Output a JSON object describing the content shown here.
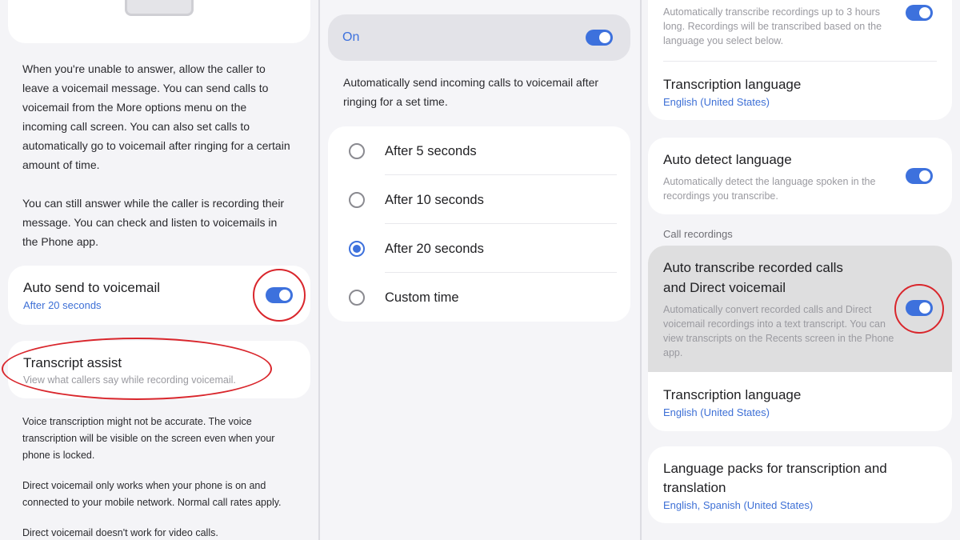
{
  "left_panel": {
    "description_paragraph_1": "When you're unable to answer, allow the caller to leave a voicemail message. You can send calls to voicemail from the More options menu on the incoming call screen. You can also set calls to automatically go to voicemail after ringing for a certain amount of time.",
    "description_paragraph_2": "You can still answer while the caller is recording their message. You can check and listen to voicemails in the Phone app.",
    "auto_send": {
      "title": "Auto send to voicemail",
      "subtitle": "After 20 seconds"
    },
    "transcript_assist": {
      "title": "Transcript assist",
      "subtitle": "View what callers say while recording voicemail."
    },
    "note_1": "Voice transcription might not be accurate. The voice transcription will be visible on the screen even when your phone is locked.",
    "note_2": "Direct voicemail only works when your phone is on and connected to your mobile network. Normal call rates apply.",
    "note_3": "Direct voicemail doesn't work for video calls."
  },
  "middle_panel": {
    "master_switch_label": "On",
    "description": "Automatically send incoming calls to voicemail after ringing for a set time.",
    "options": [
      {
        "label": "After 5 seconds",
        "selected": false
      },
      {
        "label": "After 10 seconds",
        "selected": false
      },
      {
        "label": "After 20 seconds",
        "selected": true
      },
      {
        "label": "Custom time",
        "selected": false
      }
    ]
  },
  "right_panel": {
    "top_card_description": "Automatically transcribe recordings up to 3 hours long. Recordings will be transcribed based on the language you select below.",
    "transcription_language_1": {
      "title": "Transcription language",
      "value": "English (United States)"
    },
    "auto_detect": {
      "title": "Auto detect language",
      "description": "Automatically detect the language spoken in the recordings you transcribe."
    },
    "section_header": "Call recordings",
    "auto_transcribe": {
      "title_line_1": "Auto transcribe recorded calls",
      "title_line_2": "and Direct voicemail",
      "description": "Automatically convert recorded calls and Direct voicemail recordings into a text transcript. You can view transcripts on the Recents screen in the Phone app."
    },
    "transcription_language_2": {
      "title": "Transcription language",
      "value": "English (United States)"
    },
    "language_packs": {
      "title_line_1": "Language packs for transcription and",
      "title_line_2": "translation",
      "value": "English, Spanish (United States)"
    }
  },
  "colors": {
    "accent_blue": "#3d71dd",
    "highlight_red": "#d9262c",
    "card_bg": "#ffffff",
    "panel_bg": "#f4f4f7"
  },
  "icons": {
    "toggle": "toggle-switch-on",
    "radio_selected": "radio-selected",
    "radio_unselected": "radio-unselected"
  }
}
